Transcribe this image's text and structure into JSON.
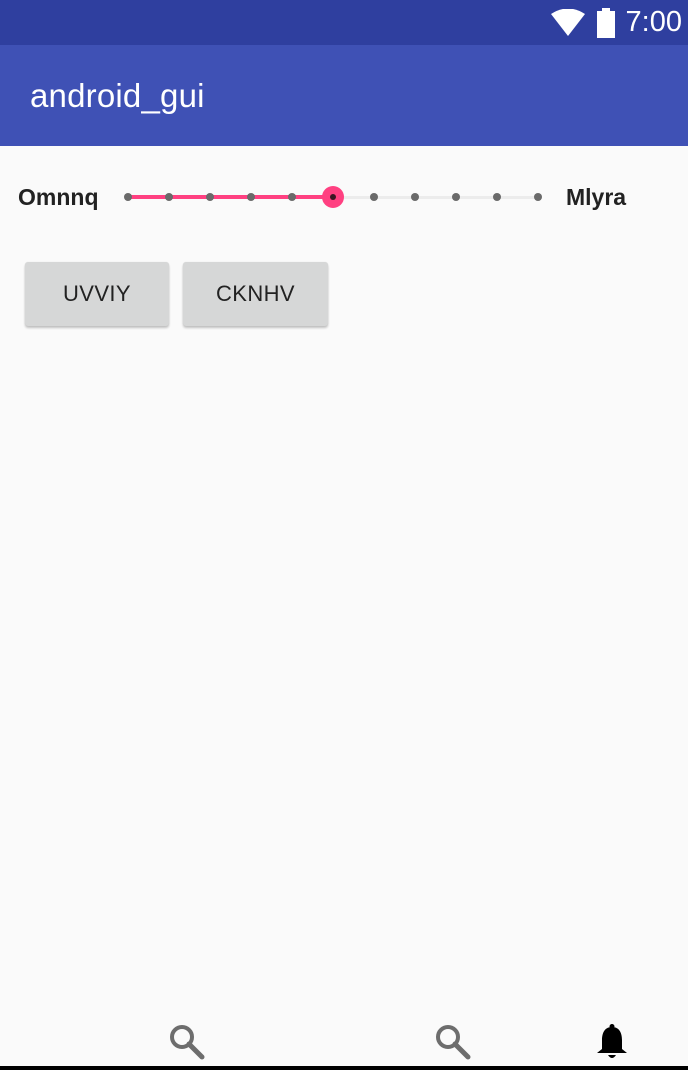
{
  "status_bar": {
    "time": "7:00",
    "icons": [
      "wifi-icon",
      "battery-icon"
    ]
  },
  "app_bar": {
    "title": "android_gui"
  },
  "seekbar": {
    "left_label": "Omnnq",
    "right_label": "Mlyra",
    "steps": 10,
    "value": 5,
    "accent_color": "#ff4081"
  },
  "buttons": [
    {
      "label": "UVVIY"
    },
    {
      "label": "CKNHV"
    }
  ],
  "bottom_nav": {
    "items": [
      {
        "icon": "search-icon"
      },
      {
        "icon": "search-icon"
      },
      {
        "icon": "bell-icon"
      }
    ]
  },
  "colors": {
    "status_bar": "#2f3f9f",
    "app_bar": "#3f51b5",
    "background": "#fafafa",
    "button": "#d6d7d7"
  }
}
